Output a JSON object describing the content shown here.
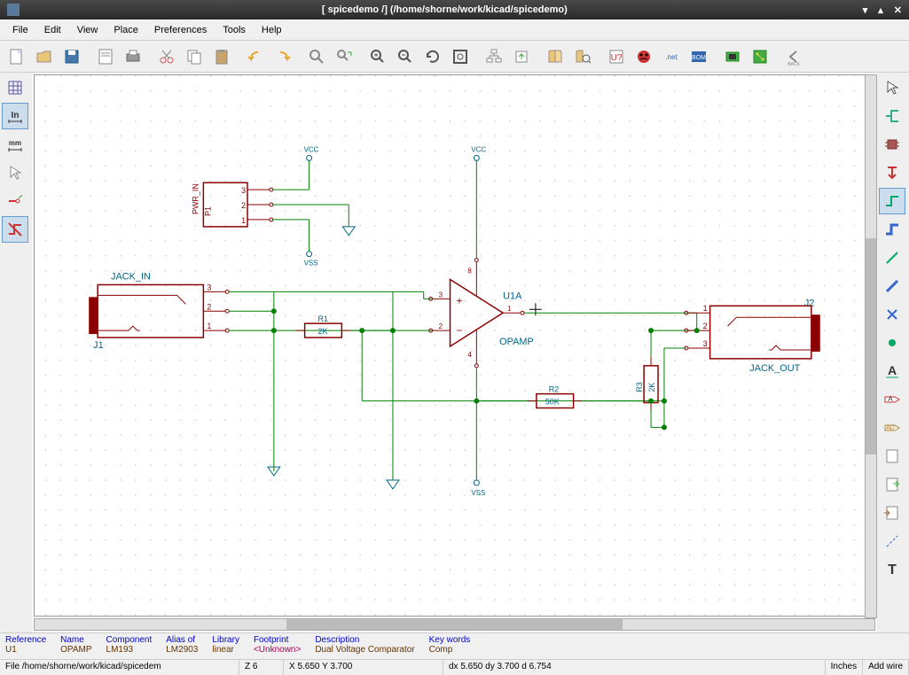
{
  "title": "[ spicedemo /] (/home/shorne/work/kicad/spicedemo)",
  "menu": [
    "File",
    "Edit",
    "View",
    "Place",
    "Preferences",
    "Tools",
    "Help"
  ],
  "info": {
    "reference": {
      "lbl": "Reference",
      "val": "U1"
    },
    "name": {
      "lbl": "Name",
      "val": "OPAMP"
    },
    "component": {
      "lbl": "Component",
      "val": "LM193"
    },
    "alias": {
      "lbl": "Alias of",
      "val": "LM2903"
    },
    "library": {
      "lbl": "Library",
      "val": "linear"
    },
    "footprint": {
      "lbl": "Footprint",
      "val": "<Unknown>"
    },
    "description": {
      "lbl": "Description",
      "val": "Dual Voltage Comparator"
    },
    "keywords": {
      "lbl": "Key words",
      "val": "Comp"
    }
  },
  "status": {
    "file": "File /home/shorne/work/kicad/spicedem",
    "zoom": "Z 6",
    "xy": "X 5.650  Y 3.700",
    "dxy": "dx 5.650  dy 3.700  d 6.754",
    "units": "Inches",
    "mode": "Add wire"
  },
  "schematic": {
    "power_in": {
      "ref": "P1",
      "label": "PWR_IN",
      "pins": [
        "1",
        "2",
        "3"
      ]
    },
    "jack_in": {
      "ref": "J1",
      "label": "JACK_IN",
      "pins": [
        "1",
        "2",
        "3"
      ]
    },
    "jack_out": {
      "ref": "J2",
      "label": "JACK_OUT",
      "pins": [
        "1",
        "2",
        "3"
      ]
    },
    "opamp": {
      "ref": "U1A",
      "label": "OPAMP",
      "pins": [
        "1",
        "2",
        "3",
        "4",
        "8"
      ]
    },
    "r1": {
      "ref": "R1",
      "val": "2K"
    },
    "r2": {
      "ref": "R2",
      "val": "50K"
    },
    "r3": {
      "ref": "R3",
      "val": "2K"
    },
    "pwr": {
      "vcc": "VCC",
      "vss": "VSS"
    }
  }
}
